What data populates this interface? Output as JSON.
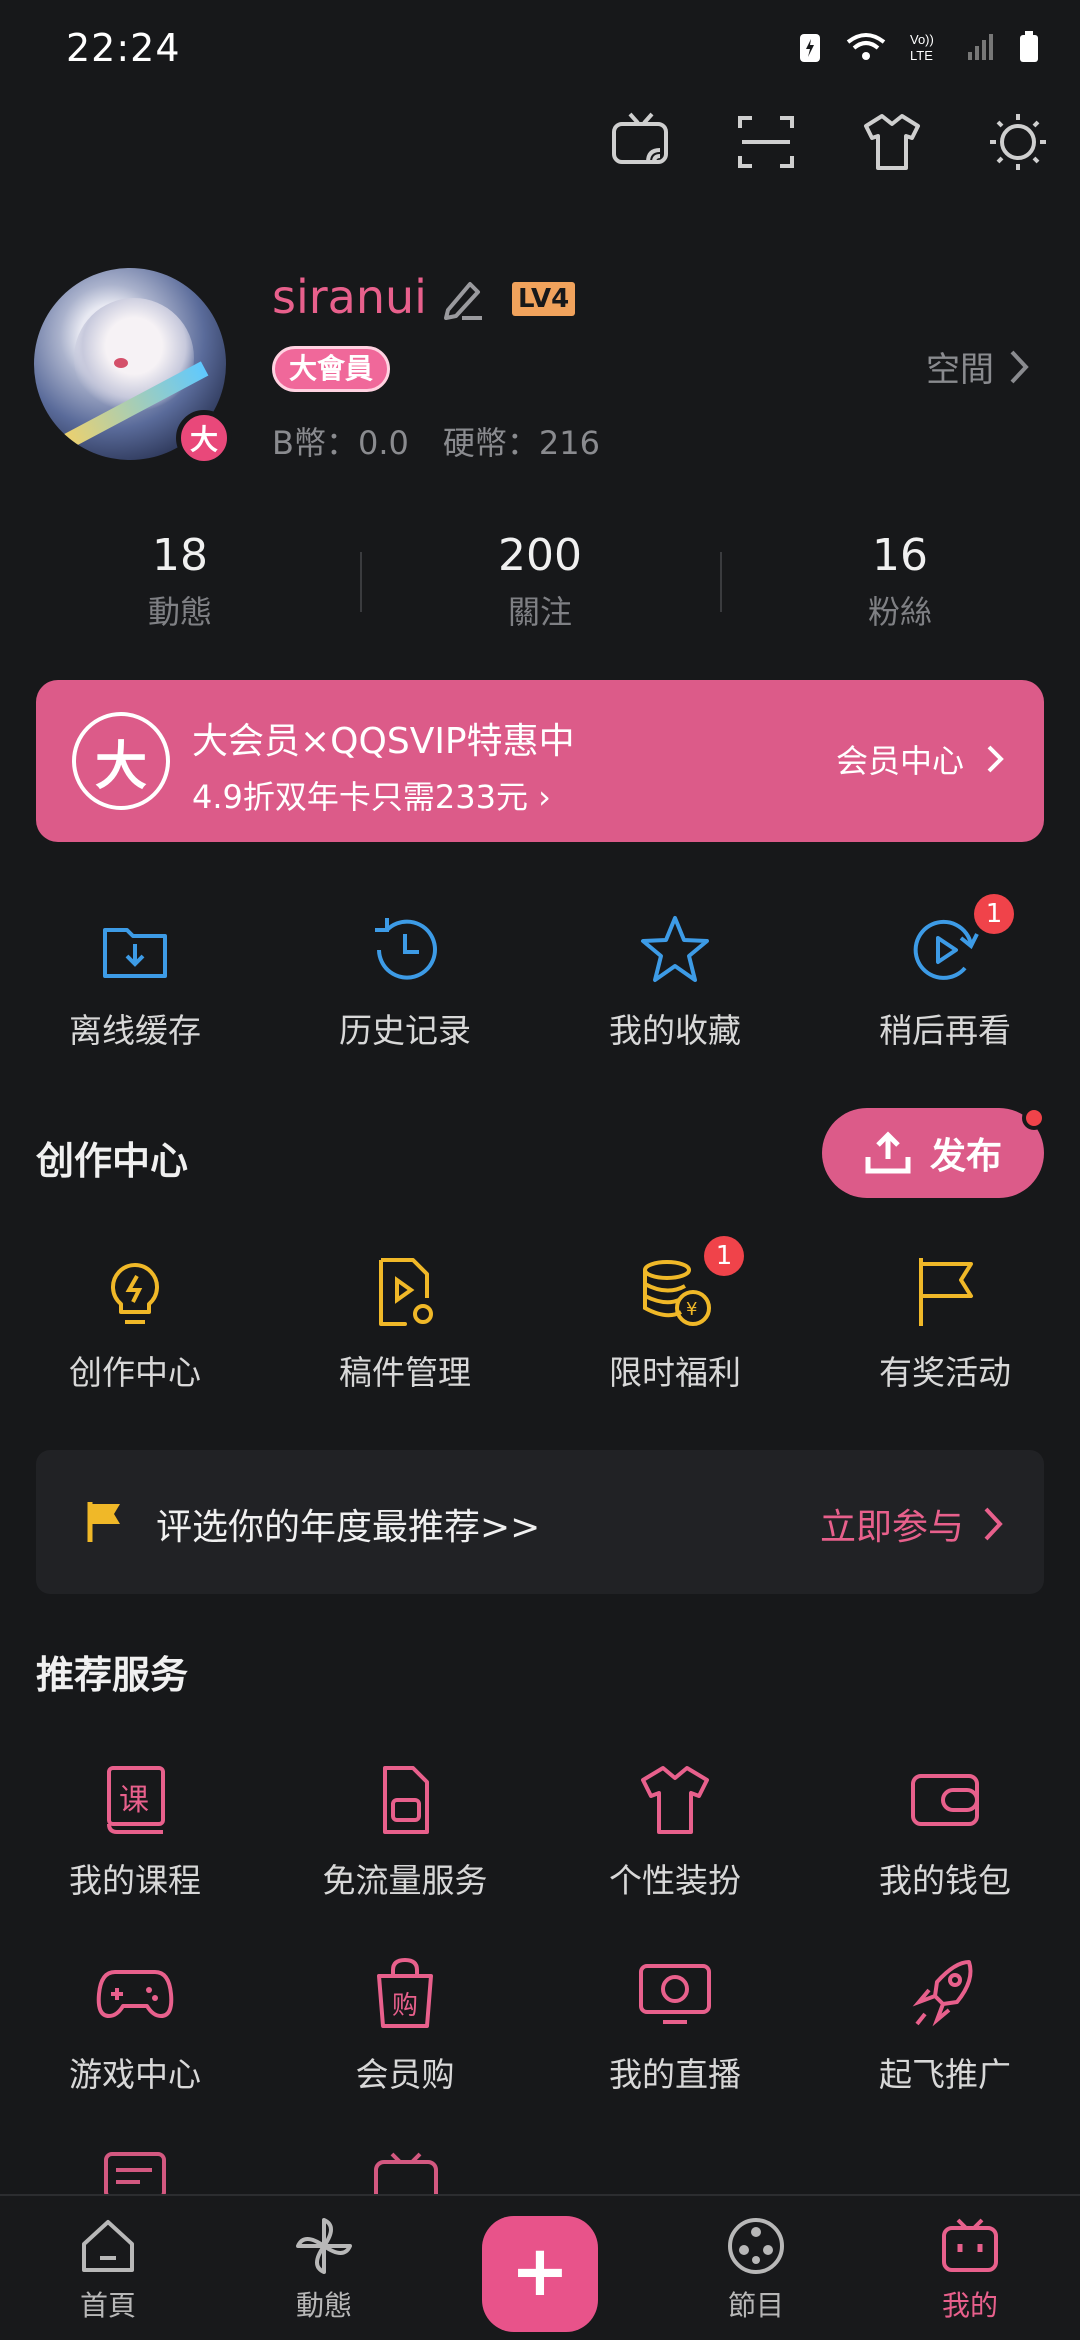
{
  "status_bar": {
    "time": "22:24"
  },
  "profile": {
    "username": "siranui",
    "level": "LV4",
    "vip_tag": "大會員",
    "avatar_badge": "大",
    "b_coin": "B幣：0.0",
    "hard_coin": "硬幣：216",
    "space_link": "空間"
  },
  "stats": [
    {
      "count": "18",
      "label": "動態"
    },
    {
      "count": "200",
      "label": "關注"
    },
    {
      "count": "16",
      "label": "粉絲"
    }
  ],
  "vip_banner": {
    "icon_char": "大",
    "title": "大会员×QQSVIP特惠中",
    "subtitle": "4.9折双年卡只需233元 ›",
    "center_link": "会员中心"
  },
  "quick_actions": [
    {
      "label": "离线缓存",
      "icon": "download-folder-icon"
    },
    {
      "label": "历史记录",
      "icon": "history-clock-icon"
    },
    {
      "label": "我的收藏",
      "icon": "star-icon"
    },
    {
      "label": "稍后再看",
      "icon": "watch-later-icon",
      "badge": "1"
    }
  ],
  "creation": {
    "title": "创作中心",
    "publish_label": "发布",
    "items": [
      {
        "label": "创作中心",
        "icon": "bulb-icon"
      },
      {
        "label": "稿件管理",
        "icon": "manuscript-icon"
      },
      {
        "label": "限时福利",
        "icon": "coins-icon",
        "badge": "1"
      },
      {
        "label": "有奖活动",
        "icon": "flag-icon"
      }
    ]
  },
  "award_banner": {
    "text": "评选你的年度最推荐>>",
    "action": "立即参与"
  },
  "services": {
    "title": "推荐服务",
    "row1": [
      {
        "label": "我的课程",
        "icon": "course-icon",
        "icon_text": "课"
      },
      {
        "label": "免流量服务",
        "icon": "sim-card-icon"
      },
      {
        "label": "个性装扮",
        "icon": "tshirt-icon"
      },
      {
        "label": "我的钱包",
        "icon": "wallet-icon"
      }
    ],
    "row2": [
      {
        "label": "游戏中心",
        "icon": "gamepad-icon"
      },
      {
        "label": "会员购",
        "icon": "shopping-bag-icon",
        "icon_text": "购"
      },
      {
        "label": "我的直播",
        "icon": "live-tv-icon"
      },
      {
        "label": "起飞推广",
        "icon": "rocket-icon"
      }
    ]
  },
  "bottom_nav": [
    {
      "label": "首頁",
      "icon": "home-icon"
    },
    {
      "label": "動態",
      "icon": "pinwheel-icon"
    },
    {
      "label": "+",
      "icon": "plus-icon"
    },
    {
      "label": "節目",
      "icon": "film-reel-icon"
    },
    {
      "label": "我的",
      "icon": "tv-face-icon"
    }
  ],
  "colors": {
    "accent": "#e8608c",
    "banner": "#dc5b89",
    "blue_icon": "#3d9be6",
    "yellow_icon": "#f0b828",
    "background": "#17181a"
  }
}
